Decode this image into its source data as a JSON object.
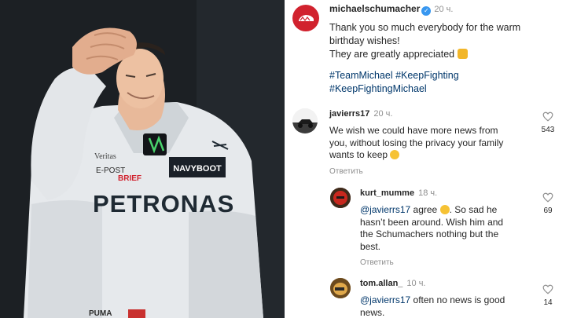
{
  "post": {
    "username": "michaelschumacher",
    "time": "20 ч.",
    "lines": [
      "Thank you so much everybody for the warm",
      "birthday wishes!",
      "They are greatly appreciated"
    ],
    "hashtags": [
      "#TeamMichael #KeepFighting",
      "#KeepFightingMichael"
    ]
  },
  "comments": [
    {
      "username": "javierrs17",
      "time": "20 ч.",
      "mention": "",
      "text_lines": [
        "We wish we could have more news from",
        "you, without losing the privacy your family",
        "wants to keep"
      ],
      "reply_label": "Ответить",
      "likes": "543"
    },
    {
      "username": "kurt_mumme",
      "time": "18 ч.",
      "mention": "@javierrs17",
      "text_first": " agree",
      "text_first_tail": ". So sad he",
      "text_lines": [
        "hasn’t been around. Wish him and",
        "the Schumachers nothing but the",
        "best."
      ],
      "reply_label": "Ответить",
      "likes": "69"
    },
    {
      "username": "tom.allan_",
      "time": "10 ч.",
      "mention": "@javierrs17",
      "text_first": " often no news is good",
      "text_lines": [
        "news."
      ],
      "likes": "14"
    }
  ],
  "photo_text": {
    "sponsor_main": "PETRONAS",
    "sponsor_badge": "NAVYBOOT",
    "sponsor_small_1": "Veritas",
    "sponsor_small_2": "E-POST",
    "sponsor_small_3": "BRIEF",
    "sponsor_bottom": "PUMA"
  },
  "colors": {
    "link": "#00376b",
    "muted": "#8e8e8e",
    "verified": "#3897f0",
    "brand_red": "#d1222e",
    "petronas_teal": "#1f2a33"
  }
}
